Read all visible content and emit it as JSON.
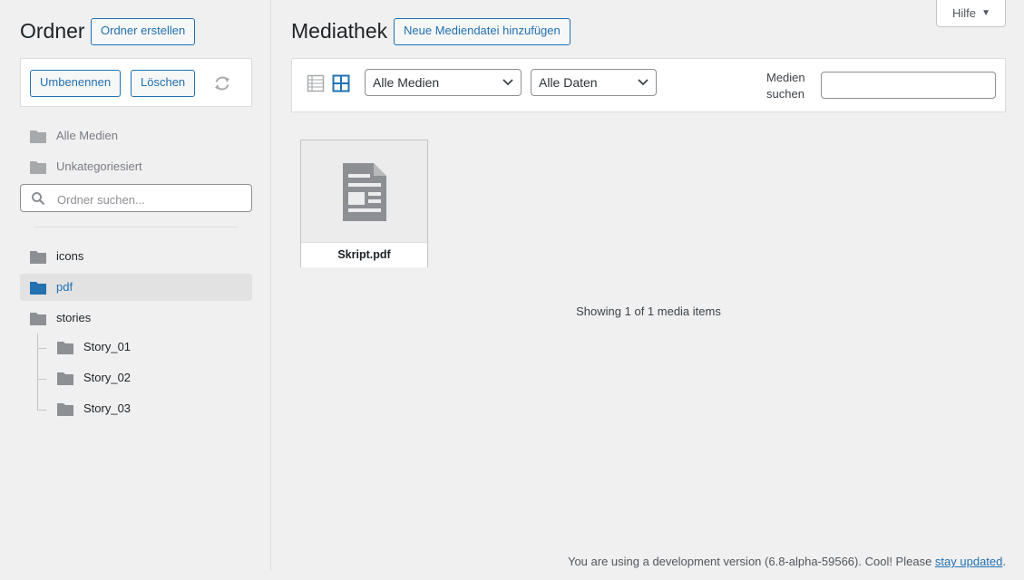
{
  "sidebar": {
    "title": "Ordner",
    "create_button": "Ordner erstellen",
    "rename_button": "Umbenennen",
    "delete_button": "Löschen",
    "fixed_items": [
      {
        "label": "Alle Medien",
        "icon": "folder-icon"
      },
      {
        "label": "Unkategoriesiert",
        "icon": "folder-icon"
      }
    ],
    "search_placeholder": "Ordner suchen...",
    "folders": [
      {
        "label": "icons",
        "active": false
      },
      {
        "label": "pdf",
        "active": true
      },
      {
        "label": "stories",
        "active": false
      }
    ],
    "subfolders": [
      {
        "label": "Story_01"
      },
      {
        "label": "Story_02"
      },
      {
        "label": "Story_03"
      }
    ]
  },
  "header": {
    "help_label": "Hilfe",
    "help_arrow": "▼",
    "title": "Mediathek",
    "add_button": "Neue Mediendatei hinzufügen"
  },
  "filters": {
    "media_type": "Alle Medien",
    "dates": "Alle Daten",
    "search_label_line1": "Medien",
    "search_label_line2": "suchen",
    "search_value": ""
  },
  "media": {
    "items": [
      {
        "filename": "Skript.pdf",
        "icon": "document-icon"
      }
    ],
    "count_text": "Showing 1 of 1 media items"
  },
  "footer": {
    "text": "You are using a development version (6.8-alpha-59566). Cool! Please ",
    "link": "stay updated",
    "suffix": "."
  },
  "colors": {
    "accent": "#2271b1",
    "background": "#f0f0f1",
    "icon_gray": "#8c8f94",
    "active_folder": "#2271b1"
  }
}
